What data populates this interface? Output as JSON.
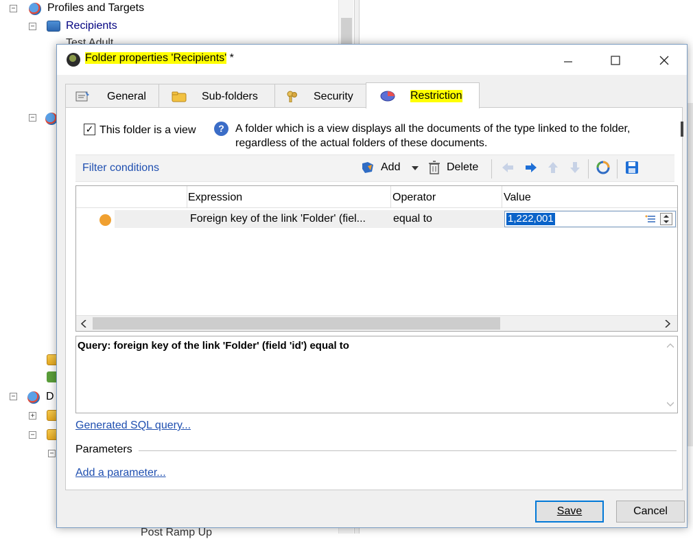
{
  "tree": {
    "profiles_label": "Profiles and Targets",
    "recipients_label": "Recipients",
    "partial_top": "Test Adult",
    "partial_d": "D",
    "partial_bottom": "Post Ramp Up"
  },
  "dialog": {
    "title_highlighted": "Folder properties 'Recipients'",
    "title_suffix": " *",
    "tabs": [
      {
        "label": "General",
        "active": false
      },
      {
        "label": "Sub-folders",
        "active": false
      },
      {
        "label": "Security",
        "active": false
      },
      {
        "label": "Restriction",
        "active": true
      }
    ],
    "view_checkbox": {
      "label": "This folder is a view",
      "checked": true
    },
    "help_text_line1": "A folder which is a view displays all the documents of the type linked to the folder,",
    "help_text_line2": "regardless of the actual folders of these documents.",
    "filter_conditions_label": "Filter conditions",
    "toolbar": {
      "add_label": "Add",
      "delete_label": "Delete"
    },
    "grid": {
      "columns": [
        "Expression",
        "Operator",
        "Value"
      ],
      "rows": [
        {
          "expression": "Foreign key of the link 'Folder' (fiel...",
          "operator": "equal to",
          "value": "1,222,001"
        }
      ]
    },
    "query_text": "Query: foreign key of the link 'Folder' (field 'id') equal to",
    "generated_sql_link": "Generated SQL query...",
    "parameters_label": "Parameters",
    "add_parameter_link": "Add a parameter...",
    "save_label": "Save",
    "cancel_label": "Cancel"
  },
  "colors": {
    "highlight": "#ffff00",
    "link": "#1f4fb0",
    "accent": "#0078d7",
    "status_dot": "#f0a030"
  }
}
